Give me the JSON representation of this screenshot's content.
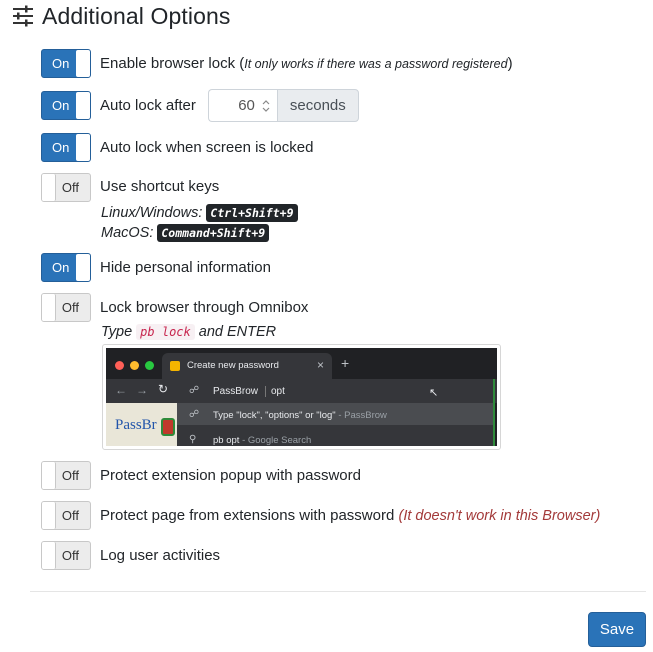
{
  "header": {
    "title": "Additional Options",
    "icon": "sliders-icon"
  },
  "options": [
    {
      "state": "On",
      "label": "Enable browser lock",
      "note_open": " (",
      "note": "It only works if there was a password registered",
      "note_close": ")"
    },
    {
      "state": "On",
      "label": "Auto lock after",
      "value": "60",
      "unit": "seconds"
    },
    {
      "state": "On",
      "label": "Auto lock when screen is locked"
    },
    {
      "state": "Off",
      "label": "Use shortcut keys"
    },
    {
      "state": "On",
      "label": "Hide personal information"
    },
    {
      "state": "Off",
      "label": "Lock browser through Omnibox"
    },
    {
      "state": "Off",
      "label": "Protect extension popup with password"
    },
    {
      "state": "Off",
      "label": "Protect page from extensions with password",
      "warning": "(It doesn't work in this Browser)"
    },
    {
      "state": "Off",
      "label": "Log user activities"
    }
  ],
  "shortcuts": {
    "linux_label": "Linux/Windows:",
    "linux_keys": "Ctrl+Shift+9",
    "mac_label": "MacOS:",
    "mac_keys": "Command+Shift+9"
  },
  "omnibox": {
    "type_word": "Type",
    "command": "pb lock",
    "and_enter": "and ENTER",
    "demo": {
      "tab_title": "Create new password",
      "tab_close": "×",
      "new_tab": "+",
      "keyword": "PassBrow",
      "typed": "opt",
      "suggestion_1": "Type \"lock\", \"options\" or \"log\"",
      "suggestion_1_source": "- PassBrow",
      "suggestion_2": "pb opt",
      "suggestion_2_source": "- Google Search",
      "logo_text": "PassBr"
    }
  },
  "footer": {
    "save_label": "Save"
  },
  "colors": {
    "accent": "#2a73b8",
    "warning": "#a33a3a",
    "kbd_bg": "#212529",
    "code_fg": "#c7254e"
  }
}
